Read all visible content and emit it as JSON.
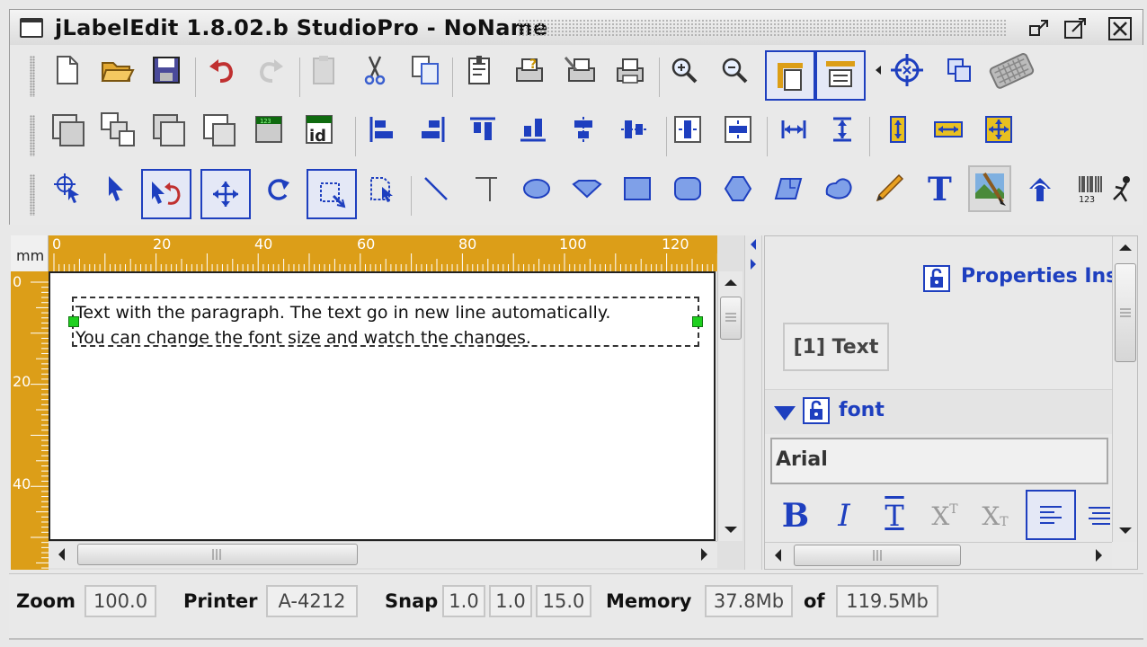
{
  "window": {
    "title": "jLabelEdit  1.8.02.b StudioPro - NoName",
    "buttons": [
      "restore-icon",
      "maximize-icon",
      "close-icon"
    ]
  },
  "toolbar1": {
    "icons": [
      "new-file-icon",
      "open-folder-icon",
      "save-icon",
      "undo-icon",
      "redo-icon",
      "paste-icon",
      "cut-icon",
      "copy-icon",
      "page-setup-icon",
      "print-help-icon",
      "printer-setup-icon",
      "print-icon",
      "zoom-in-icon",
      "zoom-out-icon",
      "page-vertical-icon",
      "page-horizontal-icon",
      "snap-target-icon",
      "window-icon",
      "keyboard-icon"
    ]
  },
  "toolbar2": {
    "icons": [
      "bring-front-icon",
      "send-back-icon",
      "bring-forward-icon",
      "send-backward-icon",
      "grid-icon",
      "id-icon",
      "align-left-icon",
      "align-right-icon",
      "align-top-icon",
      "align-bottom-icon",
      "center-horizontal-icon",
      "center-vertical-icon",
      "distribute-horizontal-icon",
      "distribute-vertical-icon",
      "same-width-icon",
      "same-height-icon",
      "resize-vertical-icon",
      "resize-horizontal-icon",
      "resize-both-icon"
    ]
  },
  "toolbar3": {
    "icons": [
      "select-target-icon",
      "pointer-icon",
      "rotate-pointer-icon",
      "move-icon",
      "rotate-icon",
      "select-area-icon",
      "edit-points-icon",
      "line-icon",
      "orthogonal-line-icon",
      "ellipse-icon",
      "diamond-icon",
      "rectangle-icon",
      "rounded-rect-icon",
      "polygon-icon",
      "parallelogram-icon",
      "blob-icon",
      "pencil-icon",
      "text-icon",
      "image-icon",
      "arrow-up-icon",
      "barcode-icon",
      "person-icon"
    ]
  },
  "editor": {
    "unit_label": "mm",
    "ruler_top": [
      "0",
      "20",
      "40",
      "60",
      "80",
      "100",
      "120"
    ],
    "ruler_left": [
      "0",
      "20",
      "40"
    ],
    "text_lines": [
      "Text with the paragraph. The text go in new line automatically.",
      "You can change the font size and watch the changes."
    ]
  },
  "properties": {
    "title": "Properties Ins",
    "object_tab": "[1] Text",
    "section": "font",
    "font_name": "Arial",
    "style_buttons": [
      "B",
      "I",
      "T",
      "X",
      "X"
    ]
  },
  "status": {
    "zoom_label": "Zoom",
    "zoom_value": "100.0",
    "printer_label": "Printer",
    "printer_value": "A-4212",
    "snap_label": "Snap",
    "snap_values": [
      "1.0",
      "1.0",
      "15.0"
    ],
    "memory_label": "Memory",
    "memory_used": "37.8Mb",
    "of_label": "of",
    "memory_total": "119.5Mb"
  },
  "colors": {
    "accent_blue": "#1e3fbf",
    "ruler_orange": "#dc9e18",
    "handle_green": "#1fd01f"
  }
}
